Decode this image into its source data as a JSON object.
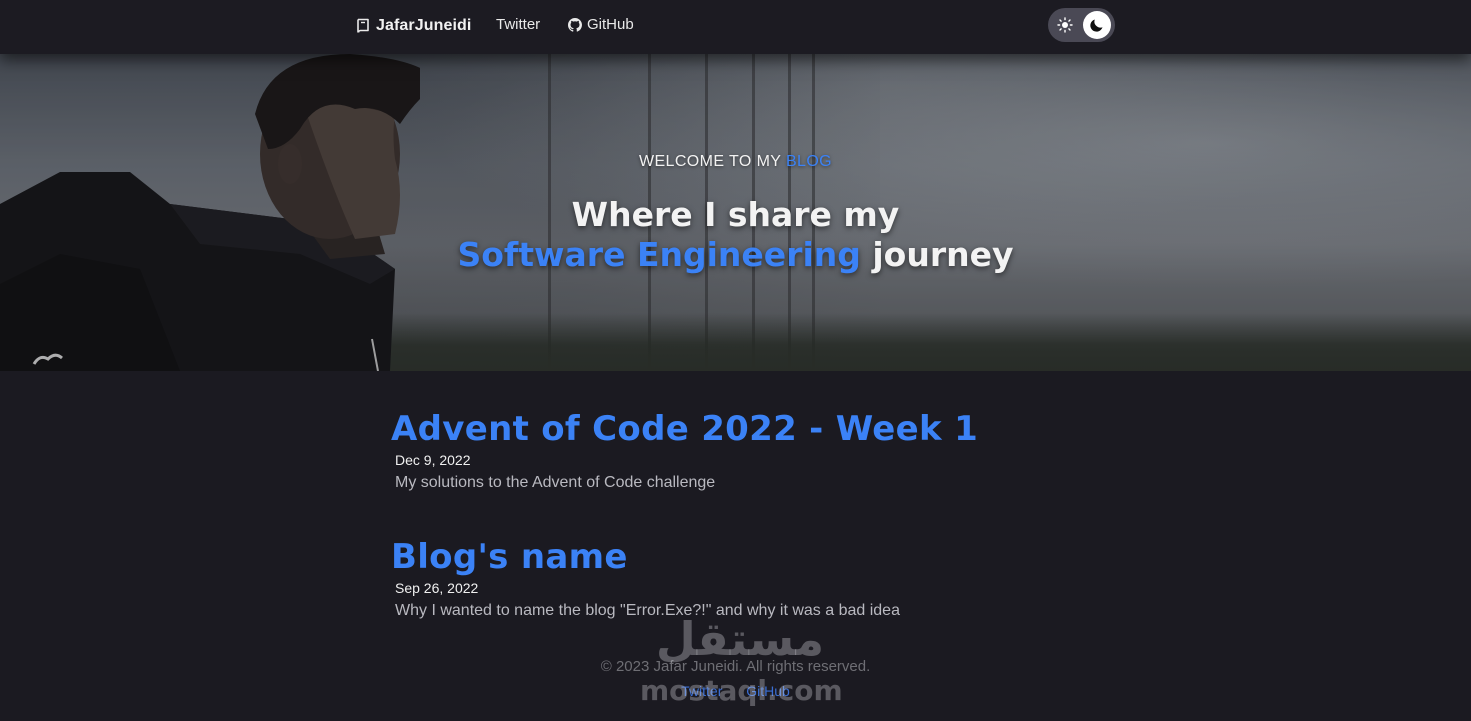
{
  "navbar": {
    "brand": {
      "icon": "book-icon",
      "label": "JafarJuneidi"
    },
    "links": [
      {
        "label": "Twitter"
      },
      {
        "label": "GitHub",
        "icon": "github-icon"
      }
    ],
    "theme_toggle": {
      "light_icon": "sun-icon",
      "dark_icon": "moon-icon",
      "mode": "dark"
    }
  },
  "hero": {
    "welcome_prefix": "WELCOME TO MY",
    "welcome_accent": "BLOG",
    "tagline_line1": "Where I share my",
    "tagline_accent": "Software Engineering",
    "tagline_suffix": "journey"
  },
  "posts": [
    {
      "title": "Advent of Code 2022 - Week 1",
      "date": "Dec 9, 2022",
      "description": "My solutions to the Advent of Code challenge"
    },
    {
      "title": "Blog's name",
      "date": "Sep 26, 2022",
      "description": "Why I wanted to name the blog \"Error.Exe?!\" and why it was a bad idea"
    }
  ],
  "footer": {
    "copyright": "© 2023 Jafar Juneidi. All rights reserved.",
    "links": [
      {
        "label": "Twitter"
      },
      {
        "label": "GitHub"
      }
    ]
  },
  "watermark": {
    "arabic": "مستقل",
    "latin": "mostaql.com"
  },
  "colors": {
    "background": "#1b1a21",
    "accent": "#3b82f6",
    "muted_text": "#b9b9c0"
  }
}
